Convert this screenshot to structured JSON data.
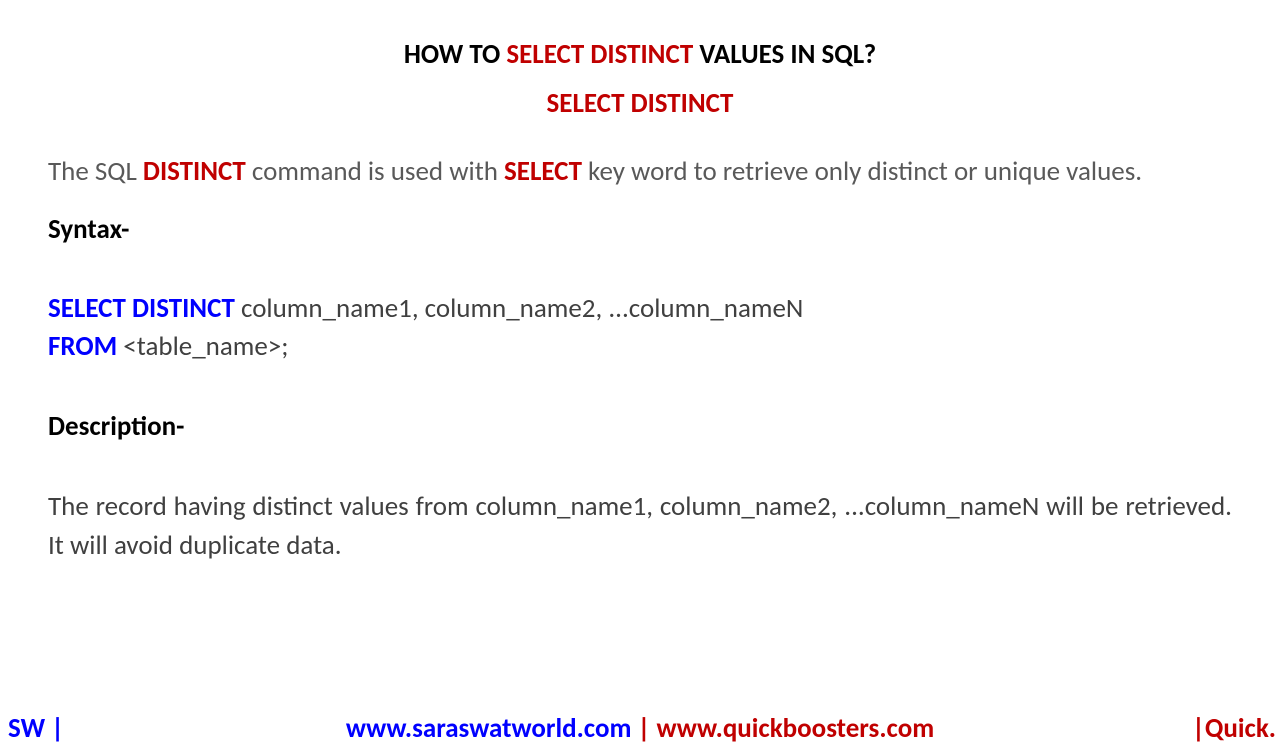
{
  "title": {
    "pre": "HOW TO ",
    "highlight": "SELECT DISTINCT",
    "post": " VALUES IN SQL?"
  },
  "subtitle": "SELECT DISTINCT",
  "intro": {
    "t1": "The SQL ",
    "kw1": "DISTINCT",
    "t2": " command is used with ",
    "kw2": "SELECT",
    "t3": " key word to retrieve only distinct or unique values."
  },
  "syntax_label": "Syntax-",
  "syntax": {
    "kw1": "SELECT DISTINCT",
    "line1_rest": " column_name1, column_name2, ...column_nameN",
    "kw2": "FROM",
    "line2_rest": " <table_name>;"
  },
  "desc_label": "Description-",
  "desc_text": "The record having distinct values from column_name1, column_name2, ...column_nameN will be retrieved. It will avoid duplicate data.",
  "footer": {
    "left": "SW |",
    "link1": "www.saraswatworld.com",
    "sep": " | ",
    "link2": "www.quickboosters.com",
    "right": "|Quick."
  }
}
